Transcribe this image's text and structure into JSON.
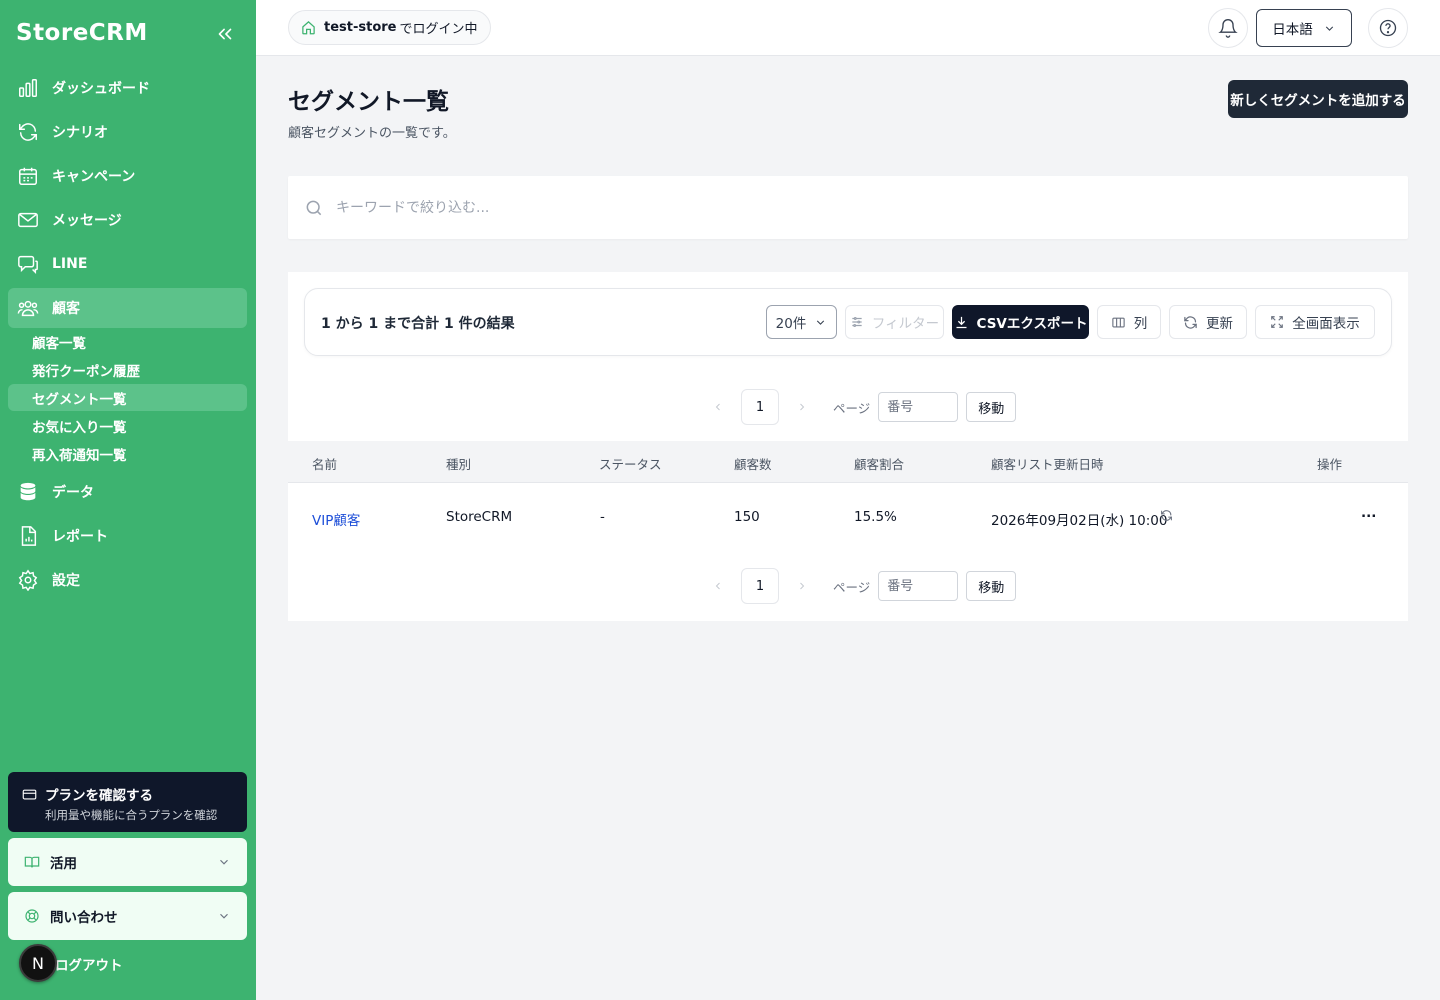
{
  "app": {
    "brand": "StoreCRM"
  },
  "sidebar": {
    "items": [
      {
        "label": "ダッシュボード",
        "icon": "bar-chart-icon"
      },
      {
        "label": "シナリオ",
        "icon": "refresh-icon"
      },
      {
        "label": "キャンペーン",
        "icon": "calendar-icon"
      },
      {
        "label": "メッセージ",
        "icon": "mail-icon"
      },
      {
        "label": "LINE",
        "icon": "chat-icon"
      },
      {
        "label": "顧客",
        "icon": "users-icon"
      },
      {
        "label": "データ",
        "icon": "database-icon"
      },
      {
        "label": "レポート",
        "icon": "file-chart-icon"
      },
      {
        "label": "設定",
        "icon": "gear-icon"
      }
    ],
    "sub_items": [
      "顧客一覧",
      "発行クーポン履歴",
      "セグメント一覧",
      "お気に入り一覧",
      "再入荷通知一覧"
    ],
    "plan": {
      "title": "プランを確認する",
      "subtitle": "利用量や機能に合うプランを確認"
    },
    "accordions": [
      "活用",
      "問い合わせ"
    ],
    "logout": "ログアウト",
    "avatar_letter": "N"
  },
  "header": {
    "store_name": "test-store",
    "store_suffix": "でログイン中",
    "language": "日本語"
  },
  "main": {
    "title": "セグメント一覧",
    "description": "顧客セグメントの一覧です。",
    "add_button": "新しくセグメントを追加する",
    "search_placeholder": "キーワードで絞り込む..."
  },
  "toolbar": {
    "result_text": "1 から 1 まで合計 1 件の結果",
    "per_page": "20件",
    "filter": "フィルター",
    "csv_export": "CSVエクスポート",
    "columns": "列",
    "refresh": "更新",
    "fullscreen": "全画面表示"
  },
  "pagination": {
    "current_page": "1",
    "page_label": "ページ",
    "input_placeholder": "番号",
    "go": "移動"
  },
  "table": {
    "headers": [
      "名前",
      "種別",
      "ステータス",
      "顧客数",
      "顧客割合",
      "顧客リスト更新日時",
      "操作"
    ],
    "rows": [
      {
        "name": "VIP顧客",
        "type": "StoreCRM",
        "status": "-",
        "count": "150",
        "ratio": "15.5%",
        "updated": "2026年09月02日(水) 10:00",
        "actions": "..."
      }
    ]
  }
}
